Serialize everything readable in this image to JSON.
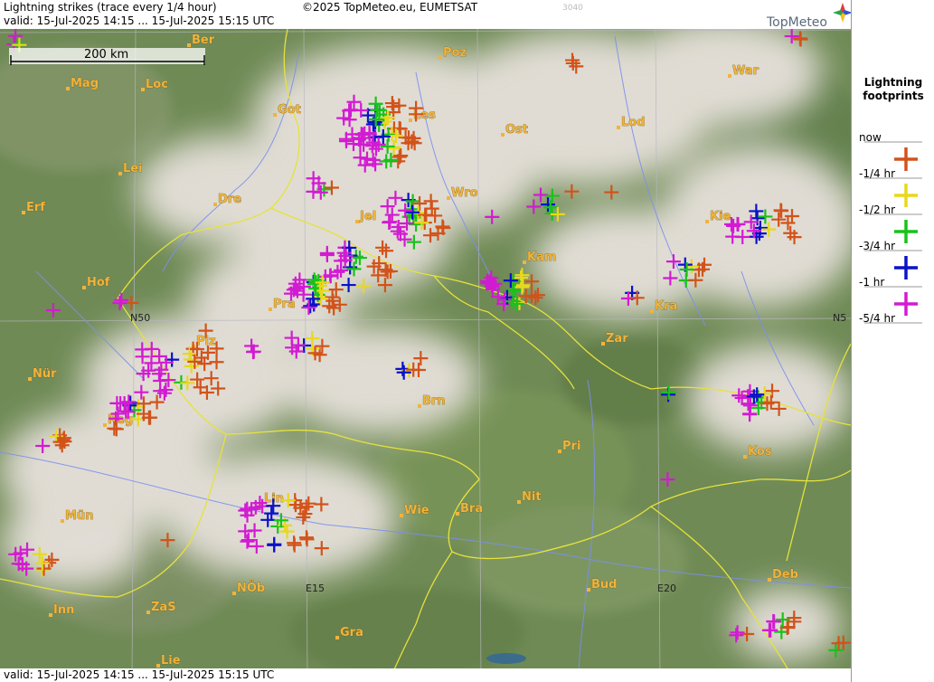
{
  "header": {
    "title": "Lightning strikes (trace every 1/4 hour)",
    "copyright": "©2025 TopMeteo.eu, EUMETSAT",
    "valid_top": "valid:  15-Jul-2025 14:15 ... 15-Jul-2025 15:15 UTC",
    "valid_bottom": "valid:  15-Jul-2025 14:15 ... 15-Jul-2025 15:15 UTC",
    "code": "3040"
  },
  "logo": {
    "text": "TopMeteo"
  },
  "scale": {
    "label": "200 km"
  },
  "grid_labels": [
    "N50",
    "N5",
    "E15",
    "E20"
  ],
  "cities": [
    "Ber",
    "Poz",
    "War",
    "Mag",
    "Loc",
    "Got",
    "Ost",
    "Lod",
    "Lei",
    "Les",
    "Dre",
    "Wro",
    "Erf",
    "Jel",
    "Kie",
    "Kam",
    "Hof",
    "Pra",
    "Kra",
    "Plz",
    "Zar",
    "Nür",
    "Brn",
    "Reg",
    "Kos",
    "Pri",
    "Nit",
    "Lin",
    "Wie",
    "Bra",
    "Mün",
    "NÖb",
    "Bud",
    "Deb",
    "Inn",
    "ZaS",
    "Gra",
    "Lie"
  ],
  "legend": {
    "title_line1": "Lightning",
    "title_line2": "footprints",
    "items": [
      {
        "label": "now",
        "color": "#d2531a"
      },
      {
        "label": "-1/4 hr",
        "color": "#e8d81c"
      },
      {
        "label": "-1/2 hr",
        "color": "#19c21b"
      },
      {
        "label": "-3/4 hr",
        "color": "#0a12c8"
      },
      {
        "label": "-1 hr",
        "color": "#d21bd2"
      },
      {
        "label": "-5/4 hr",
        "color": ""
      }
    ]
  },
  "colors": {
    "now": "#d2531a",
    "q1": "#e8d81c",
    "q2": "#19c21b",
    "q3": "#0a12c8",
    "q4": "#d21bd2",
    "city": "#f0b43c",
    "border": "#e6e23a",
    "river": "#7b8ff0",
    "land": "#6f8a55"
  }
}
